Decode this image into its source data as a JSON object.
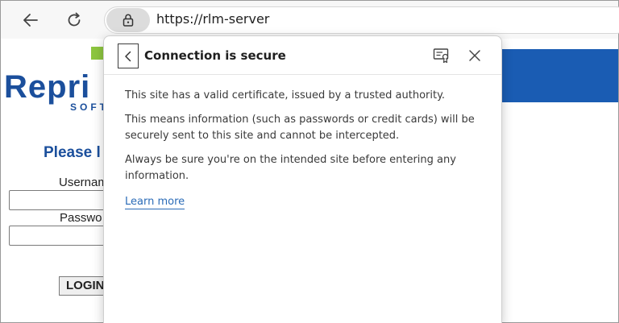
{
  "address_bar": {
    "url": "https://rlm-server",
    "lock_icon": "lock-icon",
    "back_icon": "arrow-left-icon",
    "refresh_icon": "refresh-icon"
  },
  "page": {
    "logo_text": "Repri",
    "logo_subtext": "SOFT",
    "please_text": "Please l",
    "username_label": "Usernam",
    "password_label": "Passwo",
    "login_label": "LOGIN",
    "brand_color": "#1b4f9c",
    "banner_color": "#1a5cb3",
    "logo_accent_color": "#8dc63f"
  },
  "flyout": {
    "title": "Connection is secure",
    "back_icon": "chevron-left-icon",
    "certificate_icon": "certificate-icon",
    "close_icon": "close-icon",
    "paragraphs": [
      "This site has a valid certificate, issued by a trusted authority.",
      "This means information (such as passwords or credit cards) will be securely sent to this site and cannot be intercepted.",
      "Always be sure you're on the intended site before entering any information."
    ],
    "learn_more": "Learn more"
  }
}
